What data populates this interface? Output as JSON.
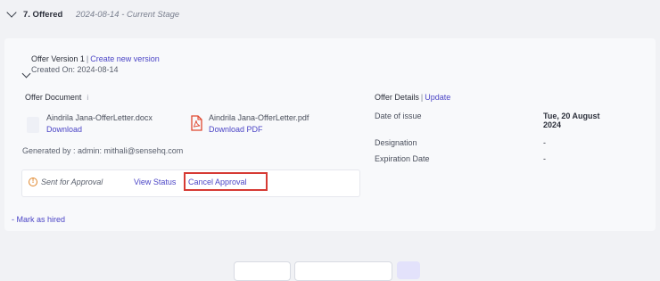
{
  "stage": {
    "title": "7. Offered",
    "meta": "2024-08-14 - Current Stage"
  },
  "version": {
    "label": "Offer Version 1",
    "separator": "|",
    "create_link": "Create new version",
    "created_on": "Created On: 2024-08-14"
  },
  "offer_document": {
    "title": "Offer Document",
    "info_mark": "i",
    "files": [
      {
        "name": "Aindrila Jana-OfferLetter.docx",
        "action": "Download",
        "icon": "document-icon"
      },
      {
        "name": "Aindrila Jana-OfferLetter.pdf",
        "action": "Download PDF",
        "icon": "pdf-icon"
      }
    ],
    "generated_by": "Generated by :  admin: mithali@sensehq.com"
  },
  "approval": {
    "status_icon": "!",
    "status": "Sent for Approval",
    "view_status": "View Status",
    "cancel": "Cancel Approval"
  },
  "mark_hired": "- Mark as hired",
  "offer_details": {
    "title": "Offer Details",
    "separator": "|",
    "update_link": "Update",
    "rows": [
      {
        "label": "Date of issue",
        "value_line1": "Tue, 20 August",
        "value_line2": "2024"
      },
      {
        "label": "Designation",
        "value": "-"
      },
      {
        "label": "Expiration Date",
        "value": "-"
      }
    ]
  },
  "colors": {
    "link": "#4b45c6",
    "highlight_border": "#d63a34",
    "warning": "#e0862b",
    "pdf": "#e0472f"
  }
}
